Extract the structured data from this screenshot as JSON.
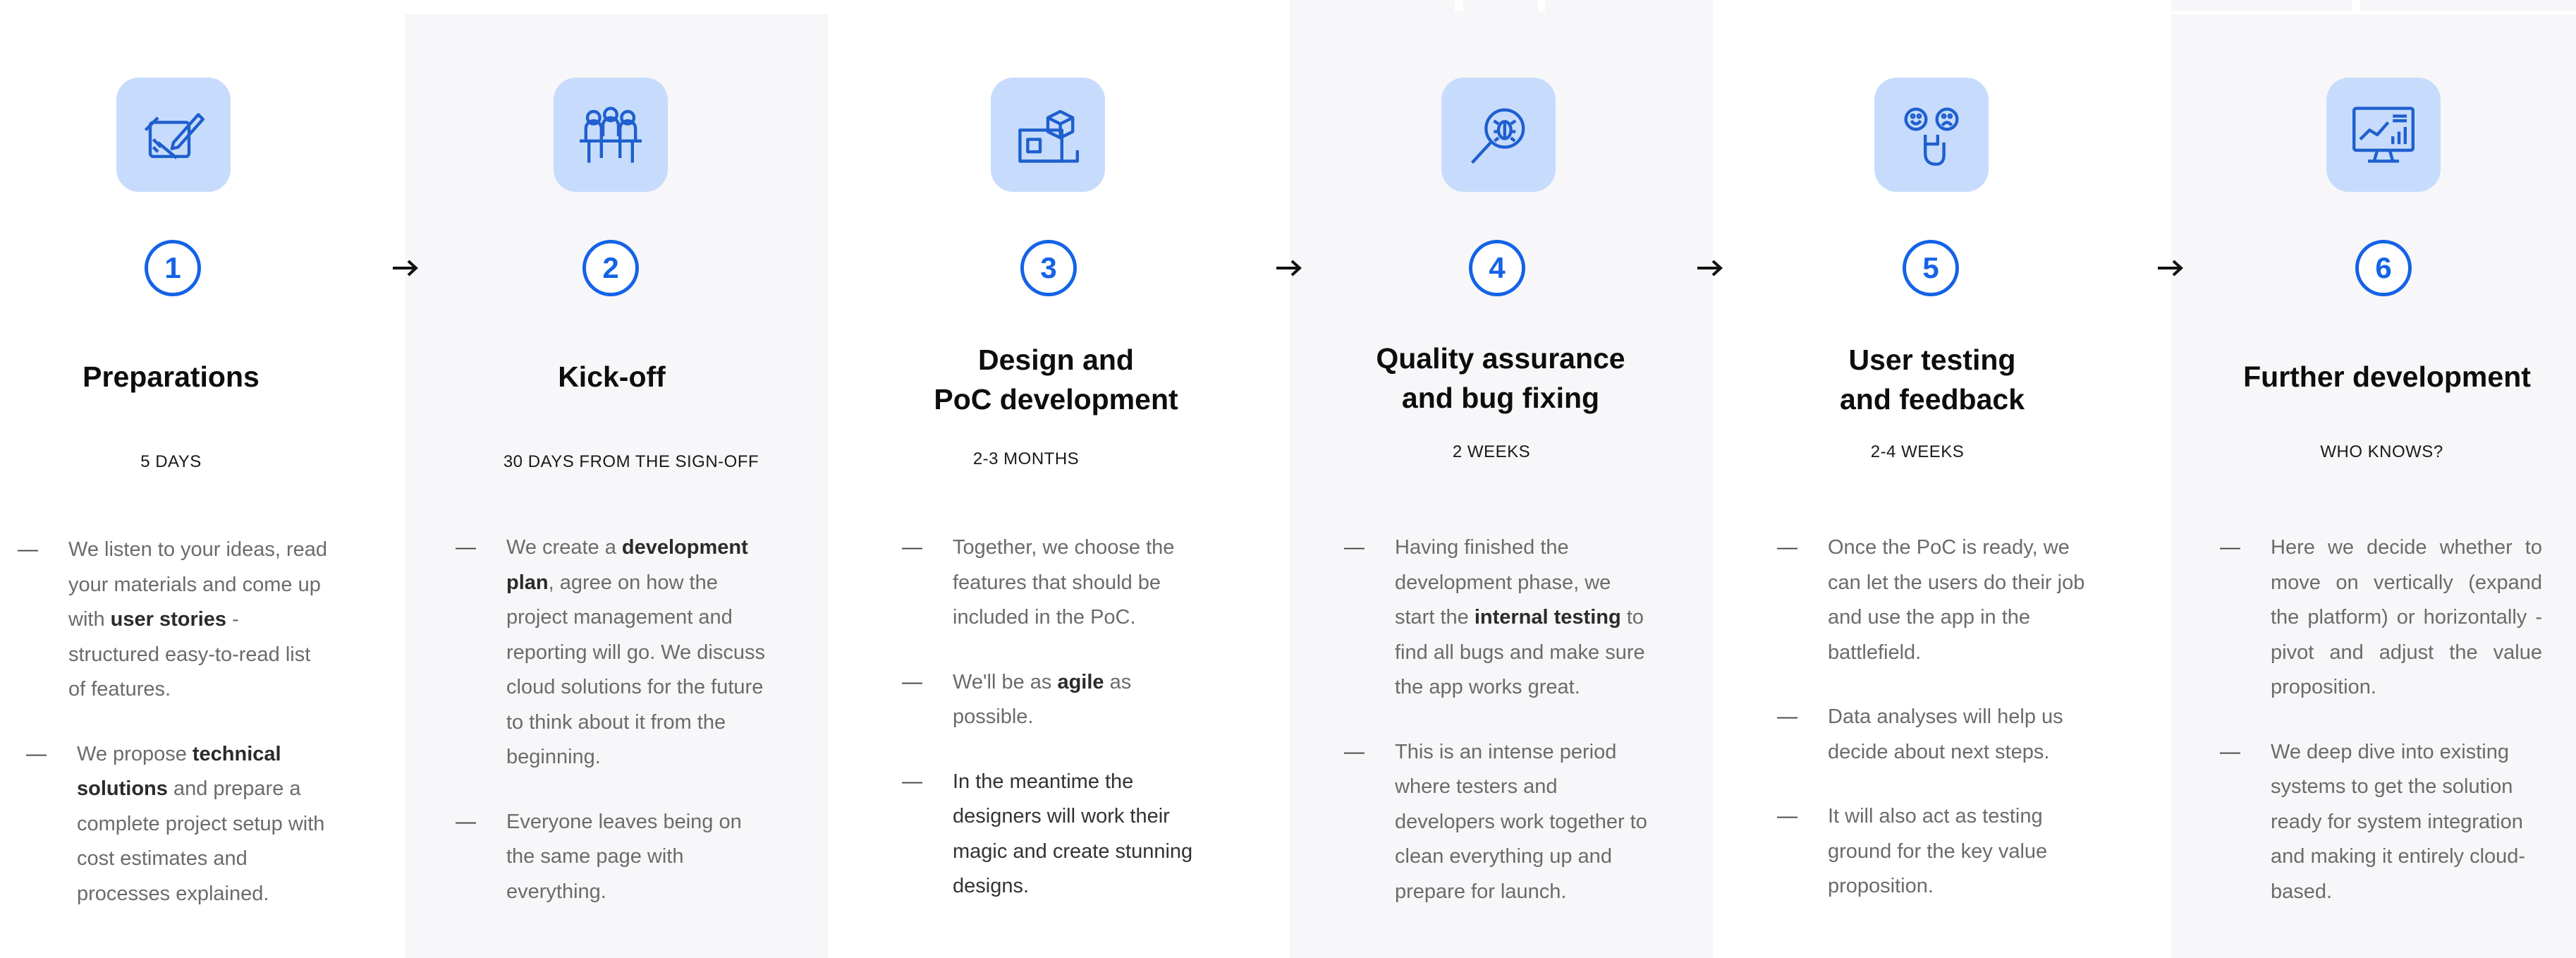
{
  "steps": [
    {
      "number": "1",
      "icon": "planning-icon",
      "title": "Preparations",
      "duration": "5 DAYS",
      "bullets": [
        {
          "pre": "We listen to your ideas, read your materials and come up with ",
          "bold": "user stories",
          "post": " - structured easy-to-read list of features."
        },
        {
          "pre": "We propose ",
          "bold": "technical solutions",
          "post": " and prepare a complete project setup with cost estimates and processes explained."
        }
      ]
    },
    {
      "number": "2",
      "icon": "team-meeting-icon",
      "title": "Kick-off",
      "duration": "30 DAYS FROM THE SIGN-OFF",
      "bullets": [
        {
          "pre": "We create a ",
          "bold": "development plan",
          "post": ", agree on how the project management and reporting will go. We discuss cloud solutions for the future to think about it from the beginning."
        },
        {
          "pre": "Everyone leaves being on the same page with everything.",
          "bold": "",
          "post": ""
        }
      ]
    },
    {
      "number": "3",
      "icon": "blueprint-box-icon",
      "title": "Design and\nPoC development",
      "duration": "2-3 MONTHS",
      "bullets": [
        {
          "pre": "Together, we choose the features that should be included in the PoC.",
          "bold": "",
          "post": ""
        },
        {
          "pre": "We'll be as ",
          "bold": "agile",
          "post": " as possible."
        },
        {
          "pre": "In the meantime the designers will work their magic and create stunning designs.",
          "bold": "",
          "post": ""
        }
      ]
    },
    {
      "number": "4",
      "icon": "bug-search-icon",
      "title": "Quality assurance\nand bug fixing",
      "duration": "2 WEEKS",
      "bullets": [
        {
          "pre": "Having finished the development phase, we start the ",
          "bold": "internal testing",
          "post": " to find all bugs and make sure the app works great."
        },
        {
          "pre": "This is an intense period where testers and developers work together to clean everything up and prepare for launch.",
          "bold": "",
          "post": ""
        }
      ]
    },
    {
      "number": "5",
      "icon": "user-feedback-icon",
      "title": "User testing\nand feedback",
      "duration": "2-4 WEEKS",
      "bullets": [
        {
          "pre": "Once the PoC is ready, we can let the users do their job and use the app in the battlefield.",
          "bold": "",
          "post": ""
        },
        {
          "pre": "Data analyses will help us decide about next steps.",
          "bold": "",
          "post": ""
        },
        {
          "pre": "It will also act as testing ground for the key value proposition.",
          "bold": "",
          "post": ""
        }
      ]
    },
    {
      "number": "6",
      "icon": "monitor-analytics-icon",
      "title": "Further development",
      "duration": "WHO KNOWS?",
      "bullets": [
        {
          "pre": "Here we decide whether to move on vertically (expand the platform) or horizontally - pivot and adjust the value proposition.",
          "bold": "",
          "post": ""
        },
        {
          "pre": "We deep dive into existing systems to get the solution ready for system integration and making it entirely cloud-based.",
          "bold": "",
          "post": ""
        }
      ]
    }
  ],
  "dash": "—",
  "colors": {
    "accent": "#1463e6",
    "tile": "#c7dcfc",
    "panel": "#f7f7f9"
  }
}
